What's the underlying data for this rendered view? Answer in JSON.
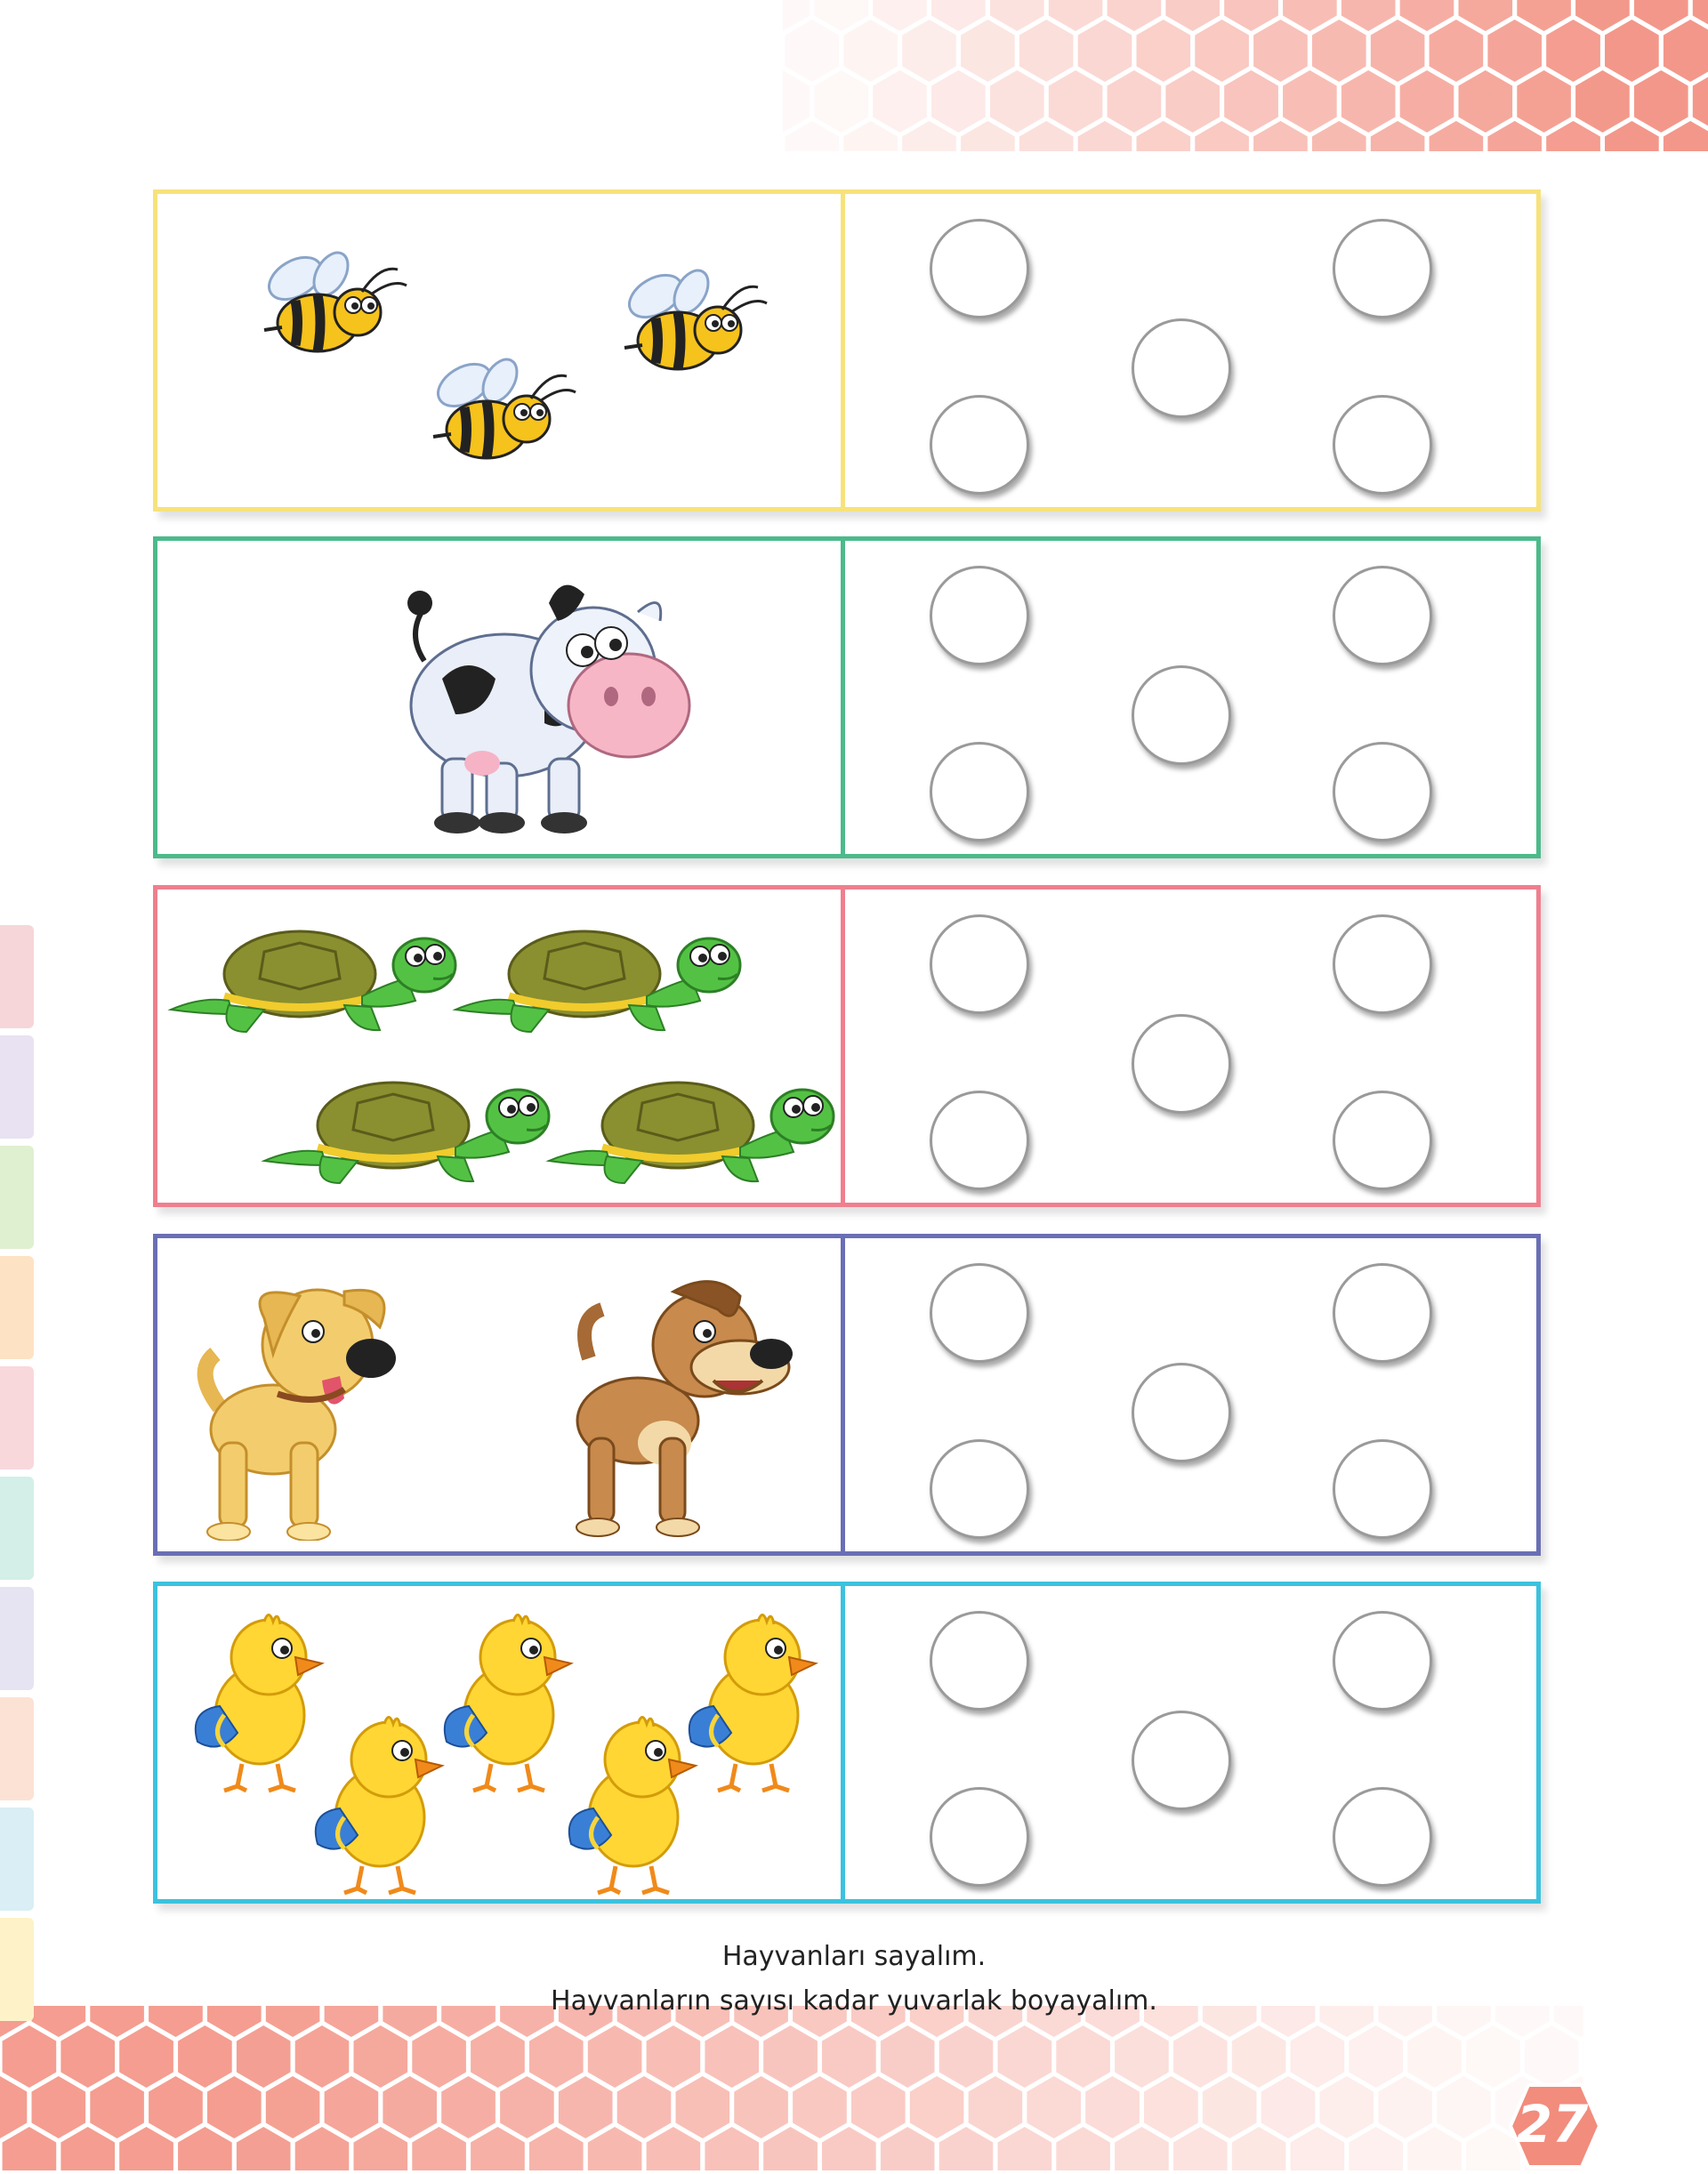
{
  "colors": {
    "row_borders": [
      "#f7e27b",
      "#4cba8a",
      "#ef7f8e",
      "#6a6fb5",
      "#3bc2de"
    ],
    "hex_pattern": "#f28c7d",
    "circle_outline": "#9a9a9a"
  },
  "rows": [
    {
      "animal": "bee",
      "count": 3,
      "circles": 5
    },
    {
      "animal": "cow",
      "count": 1,
      "circles": 5
    },
    {
      "animal": "turtle",
      "count": 4,
      "circles": 5
    },
    {
      "animal": "dog",
      "count": 2,
      "circles": 5
    },
    {
      "animal": "chick",
      "count": 5,
      "circles": 5
    }
  ],
  "instructions": {
    "line1": "Hayvanları sayalım.",
    "line2": "Hayvanların sayısı kadar yuvarlak boyayalım."
  },
  "page_number": "27"
}
